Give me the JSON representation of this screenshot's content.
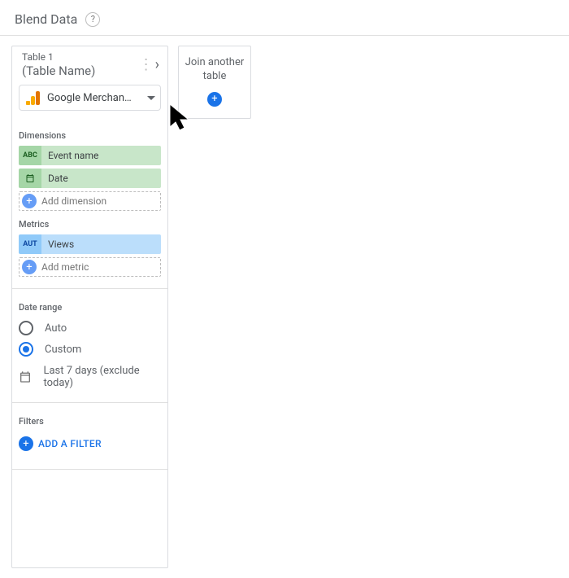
{
  "header": {
    "title": "Blend Data"
  },
  "table": {
    "id": "Table 1",
    "name": "(Table Name)",
    "source": "Google Merchan…"
  },
  "dimensions": {
    "label": "Dimensions",
    "items": [
      {
        "badge": "ABC",
        "name": "Event name"
      },
      {
        "badge": "CAL",
        "name": "Date"
      }
    ],
    "add_label": "Add dimension"
  },
  "metrics": {
    "label": "Metrics",
    "items": [
      {
        "badge": "AUT",
        "name": "Views"
      }
    ],
    "add_label": "Add metric"
  },
  "date_range": {
    "label": "Date range",
    "options": {
      "auto": "Auto",
      "custom": "Custom"
    },
    "selected": "custom",
    "value": "Last 7 days (exclude today)"
  },
  "filters": {
    "label": "Filters",
    "add_label": "ADD A FILTER"
  },
  "join": {
    "text": "Join another table"
  }
}
